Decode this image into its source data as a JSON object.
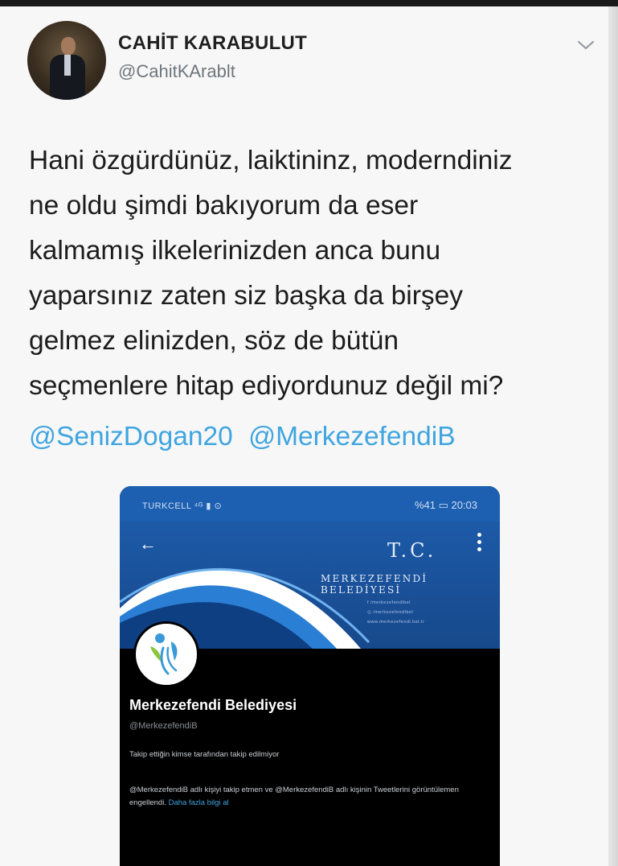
{
  "tweet": {
    "author_name": "CAHİT KARABULUT",
    "author_handle": "@CahitKArablt",
    "text_lines": [
      "Hani özgürdünüz, laiktininz, moderndiniz",
      "ne oldu şimdi bakıyorum da eser",
      "kalmamış ilkelerinizden anca bunu",
      "yaparsınız zaten siz başka da birşey",
      "gelmez elinizden, söz de bütün",
      "seçmenlere hitap ediyordunuz değil mi?"
    ],
    "mentions": [
      "@SenizDogan20",
      "@MerkezefendiB"
    ]
  },
  "embedded_screenshot": {
    "status_bar": {
      "carrier": "TURKCELL ⁴ᴳ ▮ ⊙",
      "right": "%41 ▭ 20:03"
    },
    "banner": {
      "tc": "T.C.",
      "title": "MERKEZEFENDİ BELEDİYESİ",
      "mini_lines": [
        "f  /merkezefendibel",
        "◎  /merkezefendibel",
        "www.merkezefendi.bel.tr"
      ]
    },
    "profile": {
      "name": "Merkezefendi Belediyesi",
      "handle": "@MerkezefendiB",
      "follow_note": "Takip ettiğin kimse tarafından takip edilmiyor",
      "blocked_text": "@MerkezefendiB adlı kişiyi takip etmen ve @MerkezefendiB adlı kişinin Tweetlerini görüntülemen engellendi. ",
      "learn_more": "Daha fazla bilgi al"
    }
  },
  "colors": {
    "mention_blue": "#3fa5e0",
    "banner_blue": "#1d5fb0"
  },
  "icons": [
    "chevron-down-icon",
    "back-arrow-icon",
    "more-options-icon"
  ]
}
